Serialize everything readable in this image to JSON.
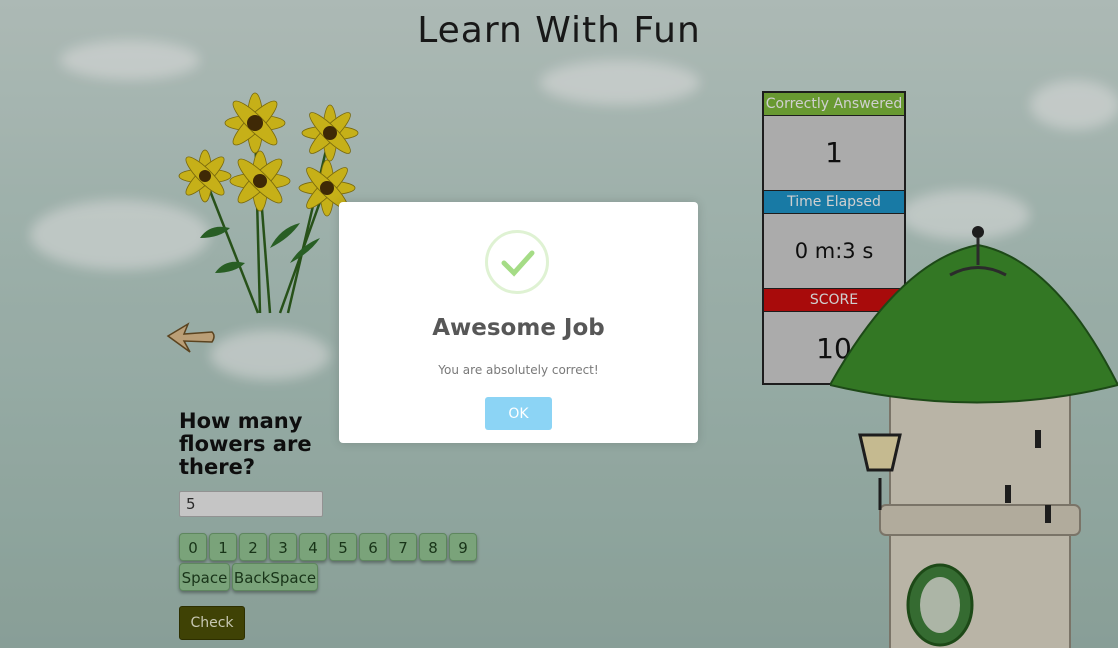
{
  "app": {
    "title": "Learn With Fun"
  },
  "question": {
    "text": "How many flowers are there?"
  },
  "answer": {
    "value": "5",
    "placeholder": ""
  },
  "keypad": {
    "digits": [
      "0",
      "1",
      "2",
      "3",
      "4",
      "5",
      "6",
      "7",
      "8",
      "9"
    ],
    "space_label": "Space",
    "backspace_label": "BackSpace"
  },
  "check_label": "Check",
  "scoreboard": {
    "correct_label": "Correctly Answered",
    "correct_value": "1",
    "time_label": "Time Elapsed",
    "time_value": "0 m:3 s",
    "score_label": "SCORE",
    "score_value": "10",
    "colors": {
      "correct": "#7ab33a",
      "time": "#1c8fc0",
      "score": "#c40d0d"
    }
  },
  "dialog": {
    "title": "Awesome Job",
    "message": "You are absolutely correct!",
    "ok_label": "OK",
    "icon": "success-check-icon",
    "accent": "#a5dc86",
    "button_color": "#8cd4f5"
  }
}
